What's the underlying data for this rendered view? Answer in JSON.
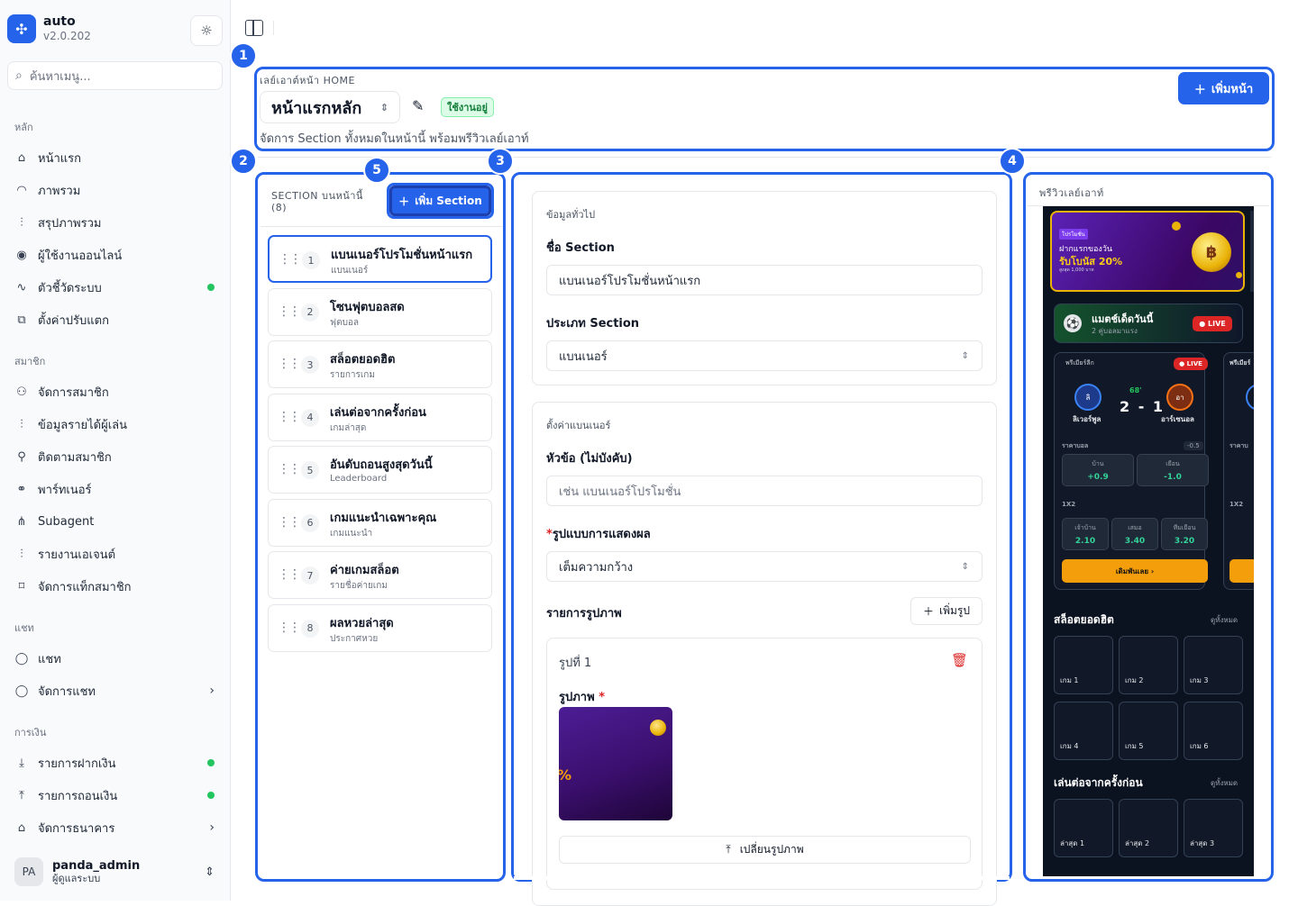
{
  "app": {
    "name": "auto",
    "version": "v2.0.202"
  },
  "search": {
    "placeholder": "ค้นหาเมนู..."
  },
  "sidebar": {
    "groups": [
      {
        "label": "หลัก",
        "items": [
          {
            "label": "หน้าแรก",
            "icon": "home-icon"
          },
          {
            "label": "ภาพรวม",
            "icon": "gauge-icon"
          },
          {
            "label": "สรุปภาพรวม",
            "icon": "bar-chart-icon"
          },
          {
            "label": "ผู้ใช้งานออนไลน์",
            "icon": "broadcast-icon"
          },
          {
            "label": "ตัวชี้วัดระบบ",
            "icon": "activity-icon",
            "indicator": true
          },
          {
            "label": "ตั้งค่าปรับแตก",
            "icon": "settings-share-icon"
          }
        ]
      },
      {
        "label": "สมาชิก",
        "items": [
          {
            "label": "จัดการสมาชิก",
            "icon": "users-icon"
          },
          {
            "label": "ข้อมูลรายได้ผู้เล่น",
            "icon": "bar-chart-icon"
          },
          {
            "label": "ติดตามสมาชิก",
            "icon": "user-search-icon"
          },
          {
            "label": "พาร์ทเนอร์",
            "icon": "handshake-icon"
          },
          {
            "label": "Subagent",
            "icon": "network-icon"
          },
          {
            "label": "รายงานเอเจนต์",
            "icon": "bar-chart-icon"
          },
          {
            "label": "จัดการแท็กสมาชิก",
            "icon": "tag-icon"
          }
        ]
      },
      {
        "label": "แชท",
        "items": [
          {
            "label": "แชท",
            "icon": "chat-icon"
          },
          {
            "label": "จัดการแชท",
            "icon": "chat-icon",
            "expandable": true
          }
        ]
      },
      {
        "label": "การเงิน",
        "items": [
          {
            "label": "รายการฝากเงิน",
            "icon": "download-icon",
            "indicator": true
          },
          {
            "label": "รายการถอนเงิน",
            "icon": "upload-icon",
            "indicator": true
          },
          {
            "label": "จัดการธนาคาร",
            "icon": "bank-icon",
            "expandable": true
          }
        ]
      }
    ]
  },
  "user": {
    "initials": "PA",
    "name": "panda_admin",
    "role": "ผู้ดูแลระบบ"
  },
  "annotations": [
    "1",
    "2",
    "3",
    "4",
    "5"
  ],
  "header": {
    "label": "เลย์เอาต์หน้า HOME",
    "page_name": "หน้าแรกหลัก",
    "status": "ใช้งานอยู่",
    "description": "จัดการ Section ทั้งหมดในหน้านี้ พร้อมพรีวิวเลย์เอาท์",
    "add_page": "เพิ่มหน้า"
  },
  "sections_panel": {
    "title_line1": "SECTION บนหน้านี้",
    "title_line2": "(8)",
    "add_button": "เพิ่ม Section",
    "items": [
      {
        "num": "1",
        "title": "แบนเนอร์โปรโมชั่นหน้าแรก",
        "sub": "แบนเนอร์"
      },
      {
        "num": "2",
        "title": "โซนฟุตบอลสด",
        "sub": "ฟุตบอล"
      },
      {
        "num": "3",
        "title": "สล็อตยอดฮิต",
        "sub": "รายการเกม"
      },
      {
        "num": "4",
        "title": "เล่นต่อจากครั้งก่อน",
        "sub": "เกมล่าสุด"
      },
      {
        "num": "5",
        "title": "อันดับถอนสูงสุดวันนี้",
        "sub": "Leaderboard"
      },
      {
        "num": "6",
        "title": "เกมแนะนำเฉพาะคุณ",
        "sub": "เกมแนะนำ"
      },
      {
        "num": "7",
        "title": "ค่ายเกมสล็อต",
        "sub": "รายชื่อค่ายเกม"
      },
      {
        "num": "8",
        "title": "ผลหวยล่าสุด",
        "sub": "ประกาศหวย"
      }
    ]
  },
  "editor": {
    "general": {
      "heading": "ข้อมูลทั่วไป",
      "name_label": "ชื่อ Section",
      "name_value": "แบนเนอร์โปรโมชั่นหน้าแรก",
      "type_label": "ประเภท Section",
      "type_value": "แบนเนอร์"
    },
    "banner": {
      "heading": "ตั้งค่าแบนเนอร์",
      "title_label": "หัวข้อ (ไม่บังคับ)",
      "title_placeholder": "เช่น แบนเนอร์โปรโมชั่น",
      "display_label": "รูปแบบการแสดงผล",
      "display_value": "เต็มความกว้าง",
      "images_label": "รายการรูปภาพ",
      "add_image": "เพิ่มรูป",
      "image_title": "รูปที่ 1",
      "image_field": "รูปภาพ",
      "thumb_pct": "%",
      "change_image": "เปลี่ยนรูปภาพ"
    }
  },
  "preview": {
    "title": "พรีวิวเลย์เอาท์",
    "banner": {
      "tag": "โปรโมชั่น",
      "line1": "ฝากแรกของวัน",
      "line2": "รับโบนัส 20%",
      "line3": "สูงสุด 1,000 บาท",
      "coin": "฿"
    },
    "match": {
      "title": "แมตช์เด็ดวันนี้",
      "sub": "2 คู่บอลมาแรง",
      "live": "● LIVE"
    },
    "game": {
      "league": "พรีเมียร์ลีก",
      "league2": "พรีเมียร์",
      "live": "● LIVE",
      "home_abbr": "ลิ",
      "home": "ลิเวอร์พูล",
      "away_abbr": "อา",
      "away": "อาร์เซนอล",
      "minute": "68'",
      "score": "2 - 1",
      "handicap_label": "ราคาบอล",
      "handicap_label2": "ราคาบ",
      "handicap": "-0.5",
      "home_odd_label": "บ้าน",
      "home_odd": "+0.9",
      "away_odd_label": "เยือน",
      "away_odd": "-1.0",
      "x12_label": "1X2",
      "x12": [
        {
          "label": "เจ้าบ้าน",
          "value": "2.10"
        },
        {
          "label": "เสมอ",
          "value": "3.40"
        },
        {
          "label": "ทีมเยือน",
          "value": "3.20"
        }
      ],
      "bet": "เดิมพันเลย ›"
    },
    "slots": {
      "heading": "สล็อตยอดฮิต",
      "all": "ดูทั้งหมด",
      "tiles": [
        "เกม 1",
        "เกม 2",
        "เกม 3",
        "เกม 4",
        "เกม 5",
        "เกม 6"
      ]
    },
    "recent": {
      "heading": "เล่นต่อจากครั้งก่อน",
      "all": "ดูทั้งหมด",
      "tiles": [
        "ล่าสุด 1",
        "ล่าสุด 2",
        "ล่าสุด 3"
      ]
    }
  },
  "colors": {
    "accent": "#2563eb",
    "success": "#22c55e",
    "danger": "#dc2626",
    "preview_bg": "#0b1220",
    "gold": "#f59e0b"
  }
}
